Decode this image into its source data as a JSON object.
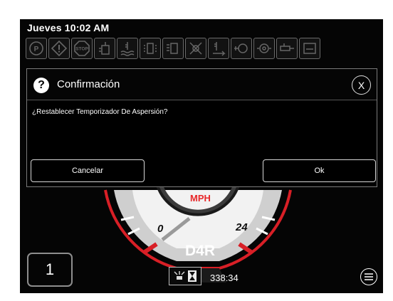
{
  "status": {
    "datetime": "Jueves 10:02 AM"
  },
  "indicators": [
    {
      "name": "parking-brake-icon",
      "text": "(P)"
    },
    {
      "name": "warning-icon",
      "text": "!"
    },
    {
      "name": "stop-icon",
      "text": "STOP"
    },
    {
      "name": "coolant-level-icon"
    },
    {
      "name": "coolant-temperature-icon"
    },
    {
      "name": "filter-icon"
    },
    {
      "name": "water-in-fuel-icon"
    },
    {
      "name": "regeneration-icon"
    },
    {
      "name": "transmission-temperature-icon"
    },
    {
      "name": "oil-level-icon"
    },
    {
      "name": "oil-pressure-icon"
    },
    {
      "name": "hydraulic-icon"
    },
    {
      "name": "fuel-icon"
    }
  ],
  "dialog": {
    "title": "Confirmación",
    "close_label": "X",
    "question_symbol": "?",
    "message": "¿Restablecer Temporizador De Aspersión?",
    "cancel_label": "Cancelar",
    "ok_label": "Ok"
  },
  "gauge": {
    "unit": "MPH",
    "min_label": "0",
    "max_label": "24",
    "gear": "D4R"
  },
  "gear_number": "1",
  "spray_timer": {
    "value": "338:34"
  }
}
